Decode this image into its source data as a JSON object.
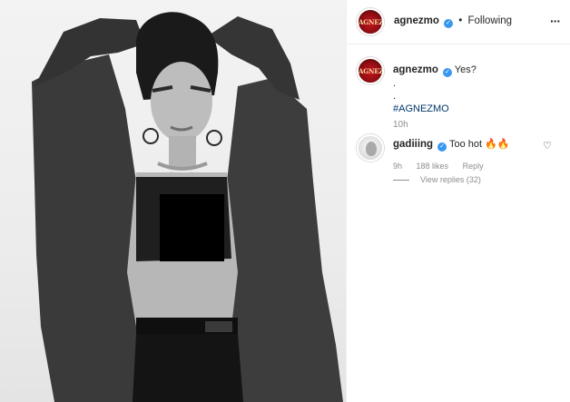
{
  "post": {
    "header": {
      "username": "agnezmo",
      "verified_icon": "verified-badge-icon",
      "separator": "•",
      "follow_status": "Following",
      "more_icon": "ellipsis-icon",
      "avatar_logo_text": "AGNEZ"
    },
    "caption": {
      "username": "agnezmo",
      "lines": [
        "Yes?",
        ".",
        "."
      ],
      "hashtag": "#AGNEZMO",
      "time": "10h"
    },
    "comments": [
      {
        "username": "gadiiing",
        "text": "Too hot",
        "emoji": "🔥🔥",
        "time": "9h",
        "likes": "188 likes",
        "reply_label": "Reply",
        "view_replies": "View replies (32)"
      }
    ]
  },
  "colors": {
    "text": "#262626",
    "muted": "#8e8e8e",
    "verified": "#3897f0",
    "hashtag": "#00376b",
    "border": "#efefef"
  }
}
